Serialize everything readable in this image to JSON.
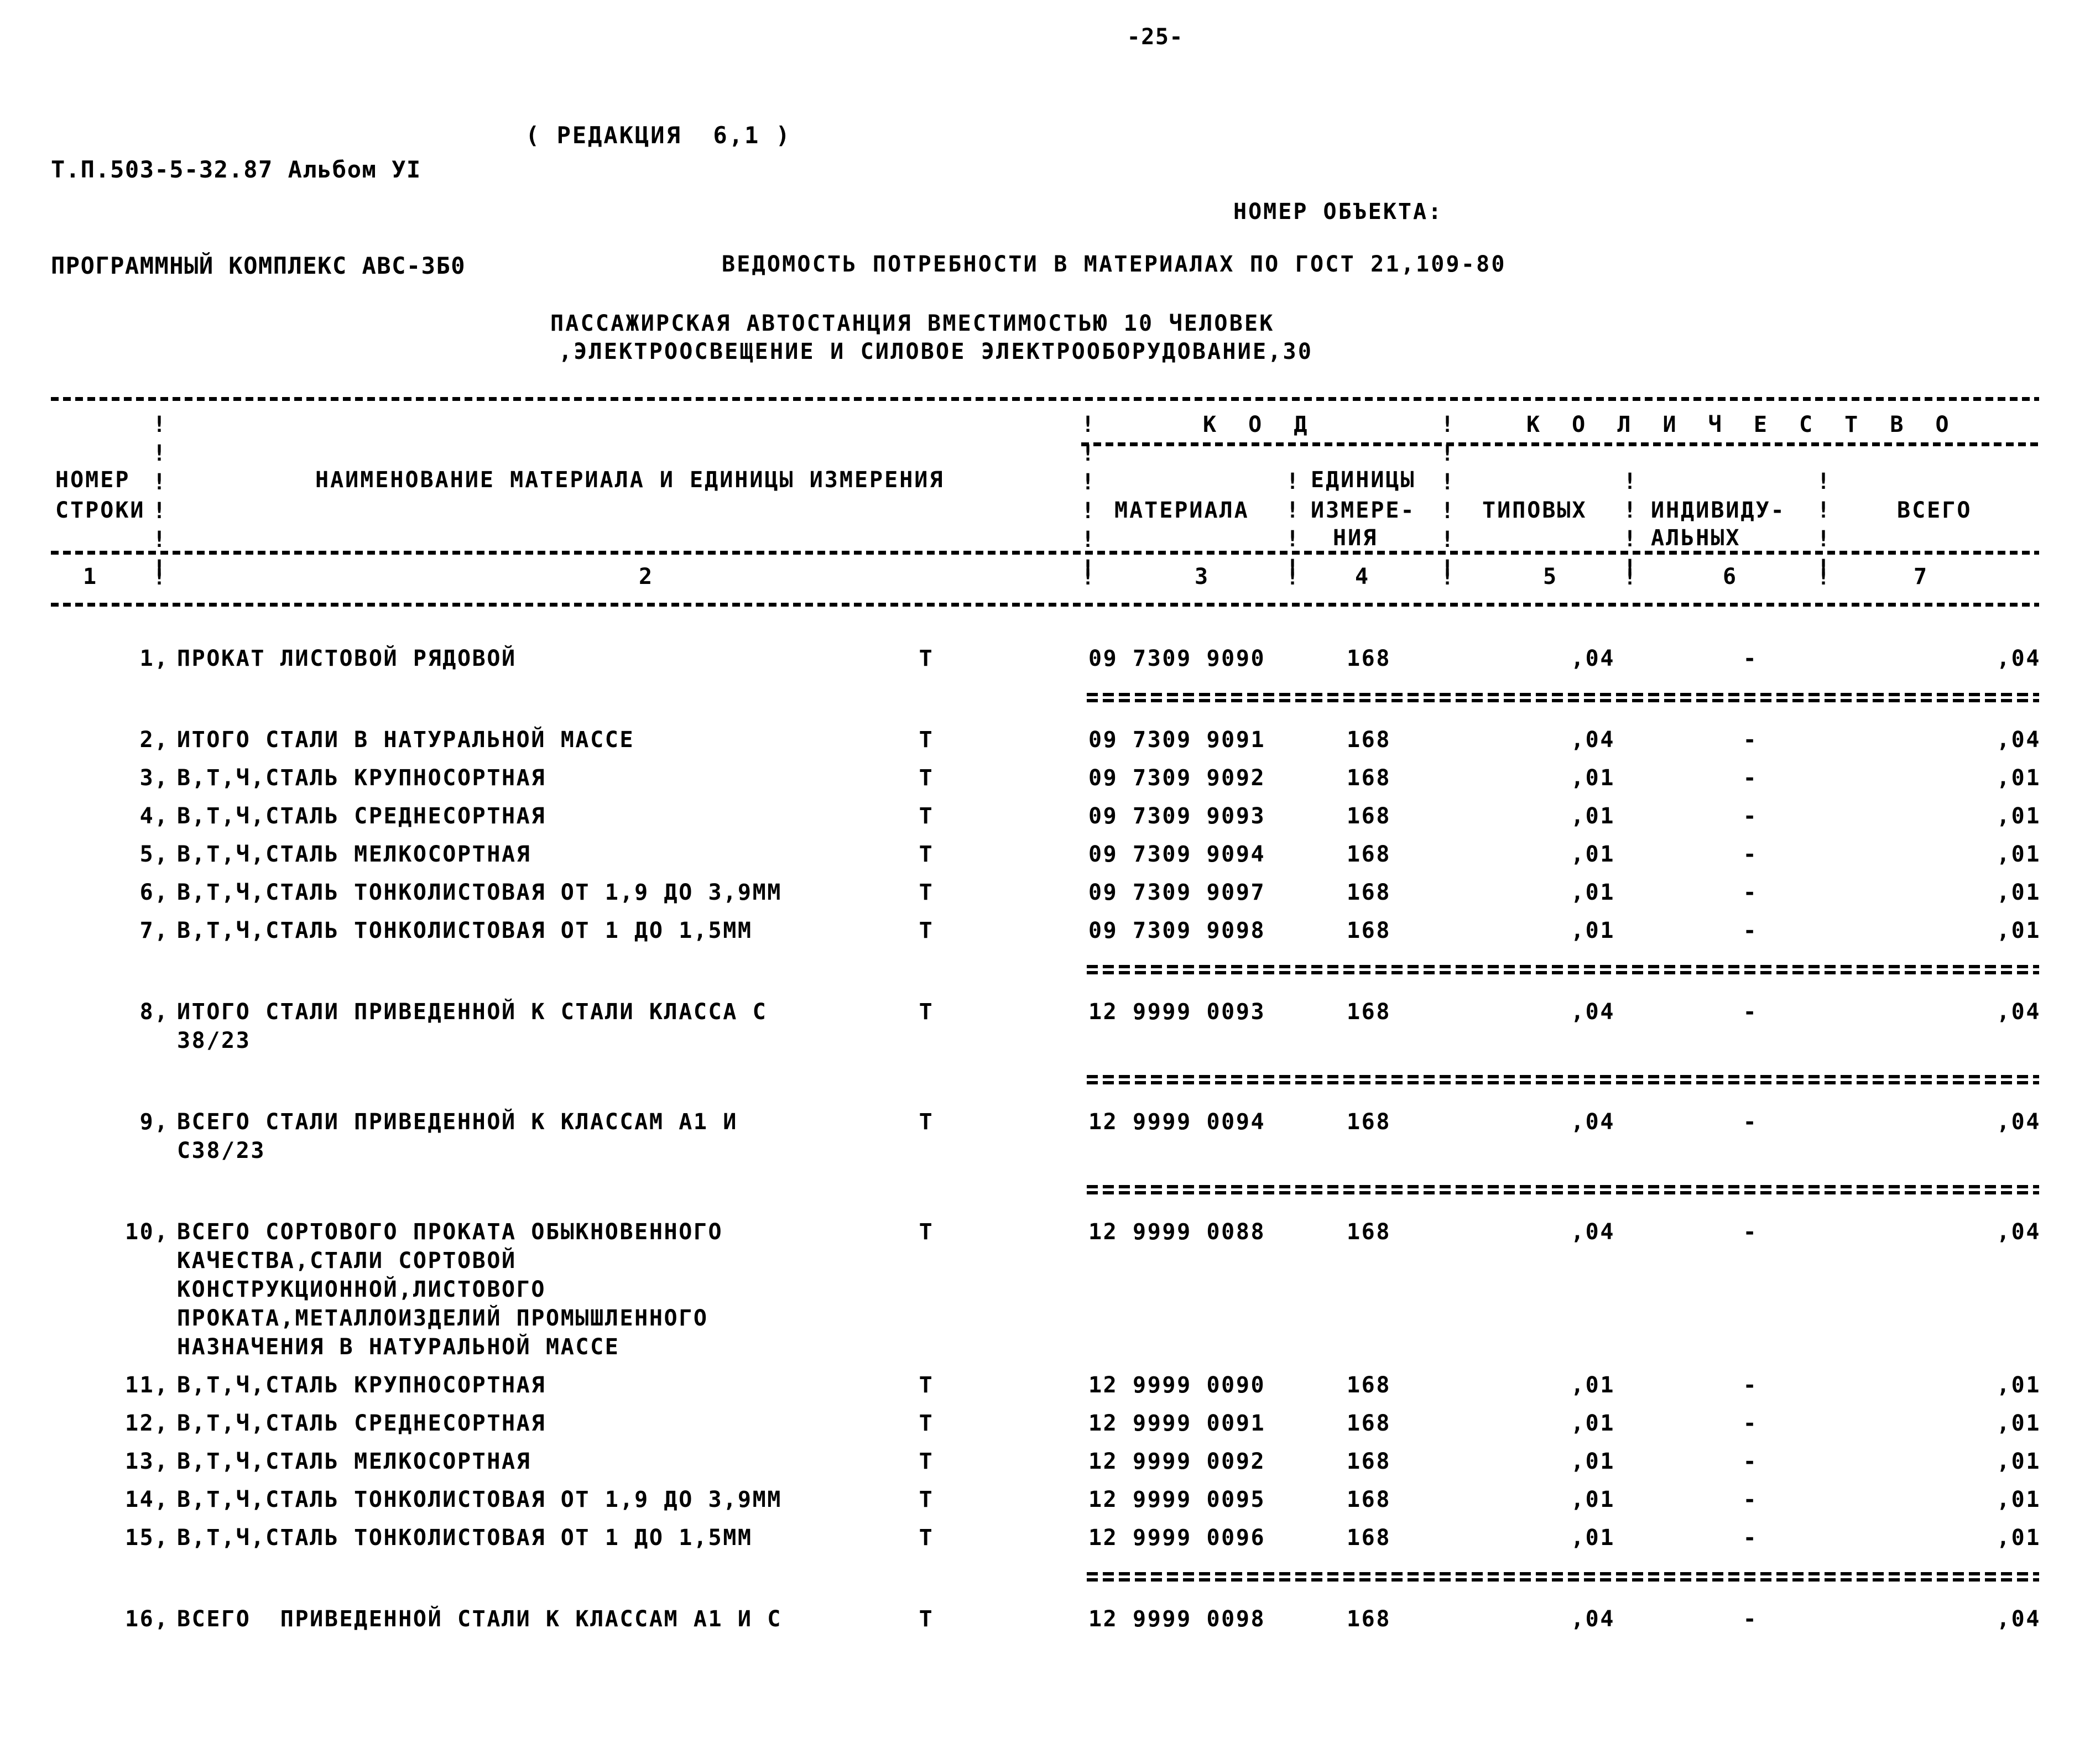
{
  "page": {
    "page_number": "-25-"
  },
  "header": {
    "doc_id_line1": "Т.П.503-5-32.87 Альбом УI",
    "doc_id_line2": "ПРОГРАММНЫЙ КОМПЛЕКС АВС-3Б0",
    "revision": "( РЕДАКЦИЯ  6,1 )",
    "object_number_label": "НОМЕР ОБЪЕКТА:",
    "title": "ВЕДОМОСТЬ ПОТРЕБНОСТИ В МАТЕРИАЛАХ ПО ГОСТ 21,109-80",
    "subtitle_line1": "ПАССАЖИРСКАЯ АВТОСТАНЦИЯ ВМЕСТИМОСТЬЮ 10 ЧЕЛОВЕК",
    "subtitle_line2": ",ЭЛЕКТРООСВЕЩЕНИЕ И СИЛОВОЕ ЭЛЕКТРООБОРУДОВАНИЕ,30"
  },
  "table": {
    "group_headers": {
      "code": "К О Д",
      "quantity": "К О Л И Ч Е С Т В О"
    },
    "columns": {
      "row_number_line1": "НОМЕР",
      "row_number_line2": "СТРОКИ",
      "name": "НАИМЕНОВАНИЕ МАТЕРИАЛА И ЕДИНИЦЫ ИЗМЕРЕНИЯ",
      "code_material": "МАТЕРИАЛА",
      "code_unit_line1": "ЕДИНИЦЫ",
      "code_unit_line2": "ИЗМЕРЕ-",
      "code_unit_line3": "НИЯ",
      "qty_typical": "ТИПОВЫХ",
      "qty_individual_line1": "ИНДИВИДУ-",
      "qty_individual_line2": "АЛЬНЫХ",
      "qty_total": "ВСЕГО"
    },
    "column_numbers": [
      "1",
      "2",
      "3",
      "4",
      "5",
      "6",
      "7"
    ],
    "rows": [
      {
        "n": "1,",
        "name": "ПРОКАТ ЛИСТОВОЙ РЯДОВОЙ",
        "extra_lines": [],
        "unit": "Т",
        "code": "09 7309 9090",
        "ei": "168",
        "typical": ",04",
        "individual": "-",
        "total": ",04",
        "separator_above": false
      },
      {
        "n": "2,",
        "name": "ИТОГО СТАЛИ В НАТУРАЛЬНОЙ МАССЕ",
        "extra_lines": [],
        "unit": "Т",
        "code": "09 7309 9091",
        "ei": "168",
        "typical": ",04",
        "individual": "-",
        "total": ",04",
        "separator_above": true
      },
      {
        "n": "3,",
        "name": "В,Т,Ч,СТАЛЬ КРУПНОСОРТНАЯ",
        "extra_lines": [],
        "unit": "Т",
        "code": "09 7309 9092",
        "ei": "168",
        "typical": ",01",
        "individual": "-",
        "total": ",01",
        "separator_above": false
      },
      {
        "n": "4,",
        "name": "В,Т,Ч,СТАЛЬ СРЕДНЕСОРТНАЯ",
        "extra_lines": [],
        "unit": "Т",
        "code": "09 7309 9093",
        "ei": "168",
        "typical": ",01",
        "individual": "-",
        "total": ",01",
        "separator_above": false
      },
      {
        "n": "5,",
        "name": "В,Т,Ч,СТАЛЬ МЕЛКОСОРТНАЯ",
        "extra_lines": [],
        "unit": "Т",
        "code": "09 7309 9094",
        "ei": "168",
        "typical": ",01",
        "individual": "-",
        "total": ",01",
        "separator_above": false
      },
      {
        "n": "6,",
        "name": "В,Т,Ч,СТАЛЬ ТОНКОЛИСТОВАЯ ОТ 1,9 ДО 3,9ММ",
        "extra_lines": [],
        "unit": "Т",
        "code": "09 7309 9097",
        "ei": "168",
        "typical": ",01",
        "individual": "-",
        "total": ",01",
        "separator_above": false
      },
      {
        "n": "7,",
        "name": "В,Т,Ч,СТАЛЬ ТОНКОЛИСТОВАЯ ОТ 1 ДО 1,5ММ",
        "extra_lines": [],
        "unit": "Т",
        "code": "09 7309 9098",
        "ei": "168",
        "typical": ",01",
        "individual": "-",
        "total": ",01",
        "separator_above": false
      },
      {
        "n": "8,",
        "name": "ИТОГО СТАЛИ ПРИВЕДЕННОЙ К СТАЛИ КЛАССА С",
        "extra_lines": [
          "38/23"
        ],
        "unit": "Т",
        "code": "12 9999 0093",
        "ei": "168",
        "typical": ",04",
        "individual": "-",
        "total": ",04",
        "separator_above": true
      },
      {
        "n": "9,",
        "name": "ВСЕГО СТАЛИ ПРИВЕДЕННОЙ К КЛАССАМ А1 И",
        "extra_lines": [
          "С38/23"
        ],
        "unit": "Т",
        "code": "12 9999 0094",
        "ei": "168",
        "typical": ",04",
        "individual": "-",
        "total": ",04",
        "separator_above": true
      },
      {
        "n": "10,",
        "name": "ВСЕГО СОРТОВОГО ПРОКАТА ОБЫКНОВЕННОГО",
        "extra_lines": [
          "КАЧЕСТВА,СТАЛИ СОРТОВОЙ",
          "КОНСТРУКЦИОННОЙ,ЛИСТОВОГО",
          "ПРОКАТА,МЕТАЛЛОИЗДЕЛИЙ ПРОМЫШЛЕННОГО",
          "НАЗНАЧЕНИЯ В НАТУРАЛЬНОЙ МАССЕ"
        ],
        "unit": "Т",
        "code": "12 9999 0088",
        "ei": "168",
        "typical": ",04",
        "individual": "-",
        "total": ",04",
        "separator_above": true
      },
      {
        "n": "11,",
        "name": "В,Т,Ч,СТАЛЬ КРУПНОСОРТНАЯ",
        "extra_lines": [],
        "unit": "Т",
        "code": "12 9999 0090",
        "ei": "168",
        "typical": ",01",
        "individual": "-",
        "total": ",01",
        "separator_above": false
      },
      {
        "n": "12,",
        "name": "В,Т,Ч,СТАЛЬ СРЕДНЕСОРТНАЯ",
        "extra_lines": [],
        "unit": "Т",
        "code": "12 9999 0091",
        "ei": "168",
        "typical": ",01",
        "individual": "-",
        "total": ",01",
        "separator_above": false
      },
      {
        "n": "13,",
        "name": "В,Т,Ч,СТАЛЬ МЕЛКОСОРТНАЯ",
        "extra_lines": [],
        "unit": "Т",
        "code": "12 9999 0092",
        "ei": "168",
        "typical": ",01",
        "individual": "-",
        "total": ",01",
        "separator_above": false
      },
      {
        "n": "14,",
        "name": "В,Т,Ч,СТАЛЬ ТОНКОЛИСТОВАЯ ОТ 1,9 ДО 3,9ММ",
        "extra_lines": [],
        "unit": "Т",
        "code": "12 9999 0095",
        "ei": "168",
        "typical": ",01",
        "individual": "-",
        "total": ",01",
        "separator_above": false
      },
      {
        "n": "15,",
        "name": "В,Т,Ч,СТАЛЬ ТОНКОЛИСТОВАЯ ОТ 1 ДО 1,5ММ",
        "extra_lines": [],
        "unit": "Т",
        "code": "12 9999 0096",
        "ei": "168",
        "typical": ",01",
        "individual": "-",
        "total": ",01",
        "separator_above": false
      },
      {
        "n": "16,",
        "name": "ВСЕГО  ПРИВЕДЕННОЙ СТАЛИ К КЛАССАМ А1 И С",
        "extra_lines": [],
        "unit": "Т",
        "code": "12 9999 0098",
        "ei": "168",
        "typical": ",04",
        "individual": "-",
        "total": ",04",
        "separator_above": true
      }
    ]
  }
}
